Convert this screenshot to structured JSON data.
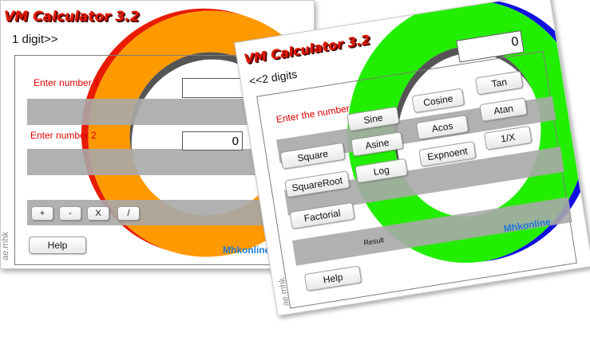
{
  "calc1": {
    "title": "VM Calculator 3.2",
    "mode_label": "1 digit>>",
    "number1_label": "Enter number 1",
    "number1_value": "",
    "number2_label": "Enter number 2",
    "number2_value": "0",
    "op_add": "+",
    "op_sub": "-",
    "op_mul": "X",
    "op_div": "/",
    "help": "Help",
    "brand": "Mhkonline",
    "side_label": "ae.mhk",
    "ring_color": "#ff9900",
    "ring_shadow": "#e81b00"
  },
  "calc2": {
    "title": "VM Calculator 3.2",
    "mode_label": "<<2 digits",
    "display_value": "0",
    "number_label": "Enter the number",
    "buttons": {
      "sine": "Sine",
      "cosine": "Cosine",
      "tan": "Tan",
      "square": "Square",
      "asine": "Asine",
      "acos": "Acos",
      "atan": "Atan",
      "squareroot": "SquareRoot",
      "log": "Log",
      "exponent": "Expnoent",
      "reciprocal": "1/X",
      "factorial": "Factorial"
    },
    "result_label": "Result",
    "help": "Help",
    "brand": "Mhkonline",
    "side_label": "ae.mhk",
    "ring_color": "#22ee00",
    "ring_shadow": "#1010e0"
  }
}
